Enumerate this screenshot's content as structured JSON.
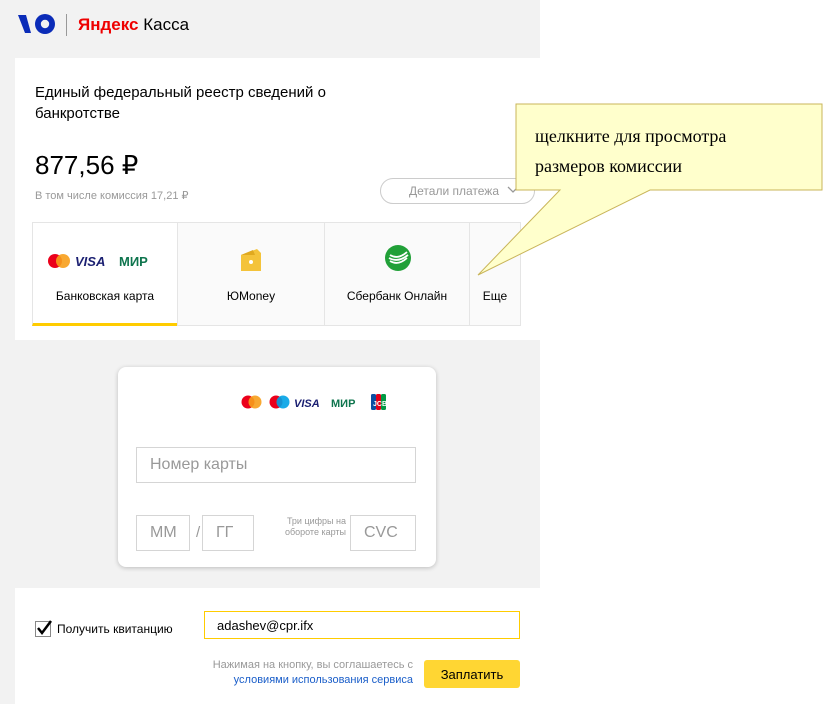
{
  "header": {
    "brand_bold": "Яндекс",
    "brand_rest": "Касса",
    "logo_icon": "yoo-logo-icon"
  },
  "payment": {
    "title": "Единый федеральный реестр сведений о банкротстве",
    "amount": "877,56 ₽",
    "commission": "В том числе комиссия 17,21 ₽",
    "details_label": "Детали платежа"
  },
  "methods": [
    {
      "label": "Банковская карта",
      "icon": "card-brands-icon",
      "selected": true
    },
    {
      "label": "ЮMoney",
      "icon": "yoomoney-wallet-icon",
      "selected": false
    },
    {
      "label": "Сбербанк Онлайн",
      "icon": "sberbank-icon",
      "selected": false
    },
    {
      "label": "Еще",
      "icon": "",
      "selected": false
    }
  ],
  "card_form": {
    "brand_visa": "VISA",
    "brand_mir": "МИР",
    "brand_jcb": "JCB",
    "card_number_placeholder": "Номер карты",
    "month_placeholder": "ММ",
    "slash": "/",
    "year_placeholder": "ГГ",
    "cvc_hint": "Три цифры на обороте карты",
    "cvc_placeholder": "CVC"
  },
  "receipt": {
    "checked": true,
    "label": "Получить квитанцию",
    "email_value": "adashev@cpr.ifx"
  },
  "footer": {
    "terms_text": "Нажимая на кнопку, вы соглашаетесь с",
    "terms_link": "условиями использования сервиса",
    "pay_label": "Заплатить"
  },
  "callout": {
    "text_line1": "щелкните для просмотра",
    "text_line2": "размеров комиссии"
  },
  "colors": {
    "accent_yellow": "#ffcc00",
    "button_yellow": "#ffd633",
    "callout_fill": "#ffffcc",
    "callout_border": "#c9b55a",
    "link_blue": "#1a5ec9"
  }
}
